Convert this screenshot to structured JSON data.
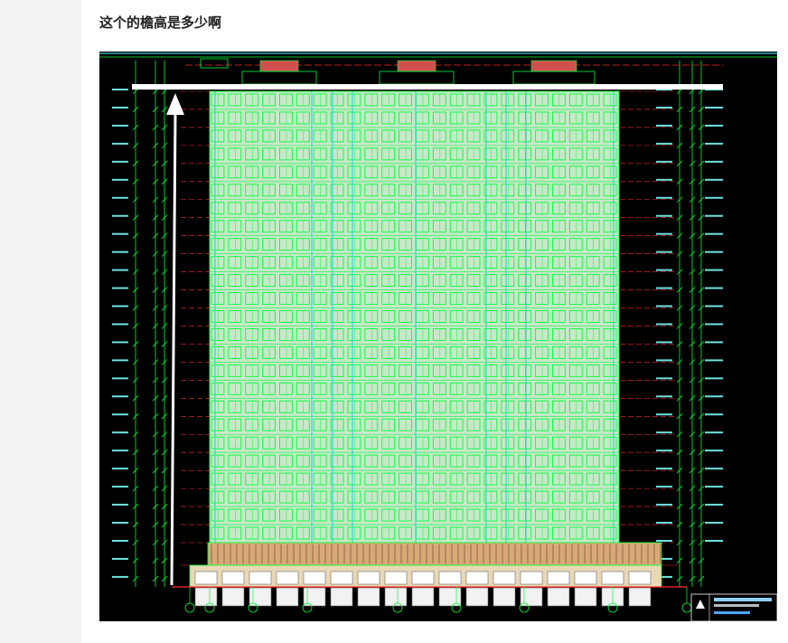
{
  "post": {
    "title": "这个的檐高是多少啊"
  },
  "image": {
    "kind": "cad-elevation-drawing",
    "floors_upper": 25,
    "floors_podium": 2,
    "colors": {
      "background": "#000000",
      "line_green": "#00ff3a",
      "line_cyan": "#35d6d6",
      "line_red": "#ff2a2a",
      "facade_fill": "#c9e7c9",
      "podium_fill": "#d9a877",
      "annotation": "#ffffff"
    }
  }
}
